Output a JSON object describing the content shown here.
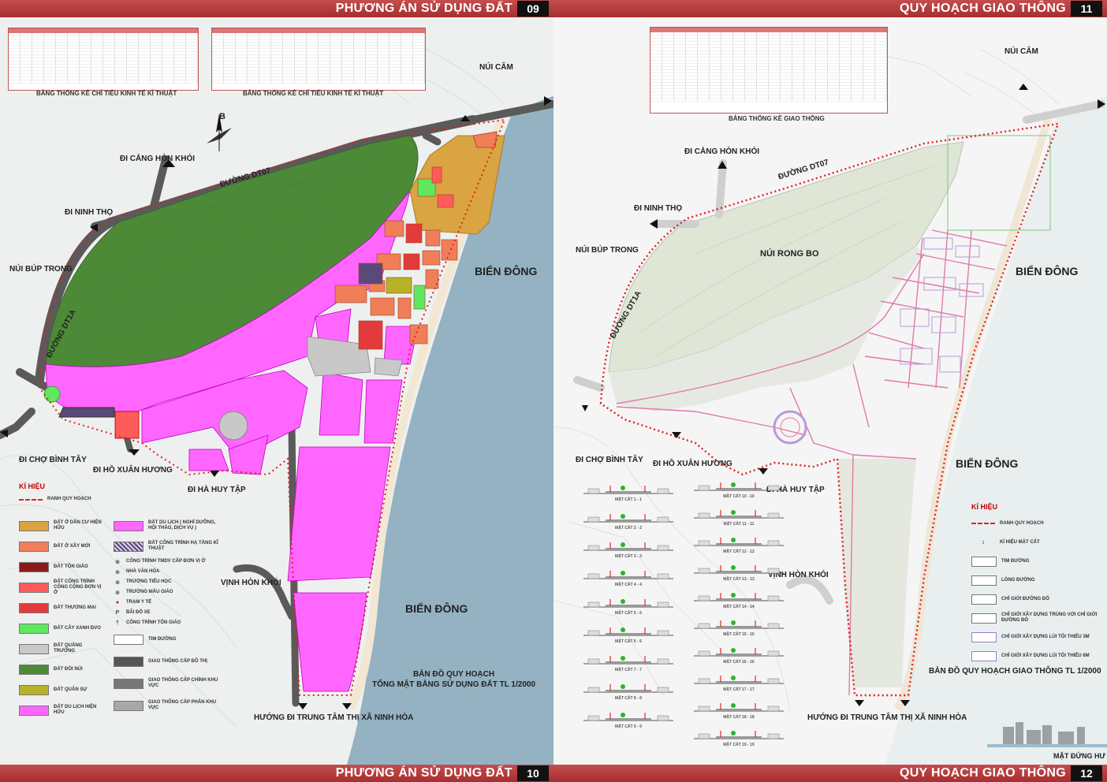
{
  "colors": {
    "orange_existing": "#d9a441",
    "orange_new": "#f07e58",
    "religion": "#8b1a1a",
    "public": "#ff5b5b",
    "commerce": "#e33b3b",
    "green": "#5fe85f",
    "square": "#c8c8c8",
    "mountain": "#4c8a38",
    "military": "#b6b329",
    "tourism": "#ff66ff",
    "infrastructure": "#5a4a7a",
    "sea": "#94b2c2",
    "road": "#5a5a5a",
    "boundary": "#e02020"
  },
  "left_page": {
    "top_bar": {
      "title": "PHƯƠNG ÁN SỬ DỤNG ĐẤT",
      "number": "09"
    },
    "bottom_bar": {
      "title": "PHƯƠNG ÁN SỬ DỤNG ĐẤT",
      "number": "10"
    },
    "table_caption_1": "BẢNG THỐNG KÊ CHỈ TIÊU KINH TẾ KĨ THUẬT",
    "table_caption_2": "BẢNG THỐNG KÊ CHỈ TIÊU KINH TẾ KĨ THUẬT",
    "labels": {
      "nui_cam": "NÚI CÂM",
      "di_cang": "ĐI CẢNG HÒN KHÓI",
      "duong_dt07": "ĐƯỜNG DT07",
      "di_ninh_tho": "ĐI NINH THỌ",
      "nui_bup_trong": "NÚI BÚP TRONG",
      "duong_dt1a": "ĐƯỜNG DT1A",
      "bien_dong_1": "BIỂN ĐÔNG",
      "bien_dong_2": "BIỂN ĐÔNG",
      "di_cho": "ĐI CHỢ BÌNH TÂY",
      "di_ho": "ĐI HỒ XUÂN HƯƠNG",
      "di_ha": "ĐI HÀ HUY TẬP",
      "vinh": "VỊNH HÒN KHÓI",
      "huong": "HƯỚNG ĐI TRUNG TÂM THỊ XÃ NINH HÒA",
      "map_title_1": "BẢN ĐỒ QUY HOẠCH",
      "map_title_2": "TỔNG MẶT BẰNG SỬ DỤNG ĐẤT TL 1/2000",
      "compass": "B"
    },
    "legend": {
      "title": "KÍ HIỆU",
      "boundary": "RANH QUY HOẠCH",
      "left": [
        {
          "label": "ĐẤT Ở DÂN CƯ HIỆN HỮU",
          "color": "#d9a441"
        },
        {
          "label": "ĐẤT Ở XÂY MỚI",
          "color": "#f07e58"
        },
        {
          "label": "ĐẤT TÔN GIÁO",
          "color": "#8b1a1a"
        },
        {
          "label": "ĐẤT CÔNG TRÌNH CÔNG CỘNG ĐƠN VỊ Ở",
          "color": "#ff5b5b"
        },
        {
          "label": "ĐẤT THƯƠNG MẠI",
          "color": "#e33b3b"
        },
        {
          "label": "ĐẤT CÂY XANH ĐVO",
          "color": "#5fe85f"
        },
        {
          "label": "ĐẤT QUẢNG TRƯỜNG",
          "color": "#c8c8c8"
        },
        {
          "label": "ĐẤT ĐỒI NÚI",
          "color": "#4c8a38"
        },
        {
          "label": "ĐẤT QUÂN SỰ",
          "color": "#b6b329"
        },
        {
          "label": "ĐẤT DU LỊCH HIỆN HỮU",
          "color": "#ff66ff"
        }
      ],
      "right_blocks": [
        {
          "label": "ĐẤT DU LỊCH ( NGHỈ DƯỠNG, HỘI THẢO, DỊCH VỤ )",
          "color": "#ff66ff"
        },
        {
          "label": "ĐẤT CÔNG TRÌNH HẠ TẦNG KĨ THUẬT",
          "color": "#5a4a7a"
        }
      ],
      "symbols": [
        {
          "label": "CÔNG TRÌNH TMDV CẤP ĐƠN VỊ Ở",
          "icon": "⊚"
        },
        {
          "label": "NHÀ VĂN HÓA",
          "icon": "⊚"
        },
        {
          "label": "TRƯỜNG TIỂU HỌC",
          "icon": "⊚"
        },
        {
          "label": "TRƯỜNG MẪU GIÁO",
          "icon": "⊚"
        },
        {
          "label": "TRẠM Y TẾ",
          "icon": "●"
        },
        {
          "label": "BÃI ĐỖ XE",
          "icon": "P"
        },
        {
          "label": "CÔNG TRÌNH TÔN GIÁO",
          "icon": "†"
        }
      ],
      "roads": [
        {
          "label": "TIM ĐƯỜNG",
          "color": "#ffffff"
        },
        {
          "label": "GIAO THÔNG CẤP ĐÔ THỊ",
          "color": "#555555"
        },
        {
          "label": "GIAO THÔNG CẤP CHÍNH KHU VỰC",
          "color": "#777777"
        },
        {
          "label": "GIAO THÔNG CẤP PHÂN KHU VỰC",
          "color": "#a8a8a8"
        }
      ]
    }
  },
  "right_page": {
    "top_bar": {
      "title": "QUY HOẠCH GIAO THÔNG",
      "number": "11"
    },
    "bottom_bar": {
      "title": "QUY HOẠCH GIAO THÔNG",
      "number": "12"
    },
    "table_caption": "BẢNG THỐNG KÊ GIAO THÔNG",
    "labels": {
      "nui_cam": "NÚI CÂM",
      "di_cang": "ĐI CẢNG HÒN KHÓI",
      "duong_dt07": "ĐƯỜNG DT07",
      "di_ninh_tho": "ĐI NINH THỌ",
      "nui_bup_trong": "NÚI BÚP TRONG",
      "nui_rong_bo": "NÚI RONG BO",
      "duong_dt1a": "ĐƯỜNG DT1A",
      "bien_dong_1": "BIỂN ĐÔNG",
      "bien_dong_2": "BIỂN ĐÔNG",
      "di_cho": "ĐI CHỢ BÌNH TÂY",
      "di_ho": "ĐI HỒ XUÂN HƯƠNG",
      "di_ha": "ĐI HÀ HUY TẬP",
      "vinh": "VỊNH HÒN KHÓI",
      "huong": "HƯỚNG ĐI TRUNG TÂM THỊ XÃ NINH HÒA",
      "map_title": "BẢN ĐỒ QUY HOẠCH GIAO THÔNG TL 1/2000",
      "mat_dung": "MẶT ĐỨNG HƯ"
    },
    "legend": {
      "title": "KÍ HIỆU",
      "items": [
        {
          "label": "RANH QUY HOẠCH",
          "kind": "boundary"
        },
        {
          "label": "KÍ HIỆU MẶT CẮT",
          "kind": "cut"
        },
        {
          "label": "TIM ĐƯỜNG",
          "kind": "box"
        },
        {
          "label": "LÒNG ĐƯỜNG",
          "kind": "box"
        },
        {
          "label": "CHỈ GIỚI ĐƯỜNG ĐỎ",
          "kind": "box"
        },
        {
          "label": "CHỈ GIỚI XÂY DỰNG TRÙNG VỚI CHỈ GIỚI ĐƯỜNG ĐỎ",
          "kind": "box"
        },
        {
          "label": "CHỈ GIỚI XÂY DỰNG LÙI TỐI THIỂU 3M",
          "kind": "box-purple"
        },
        {
          "label": "CHỈ GIỚI XÂY DỰNG LÙI TỐI THIỂU 6M",
          "kind": "box-purple"
        }
      ]
    },
    "sections_left": [
      "MẶT CẮT 1 - 1",
      "MẶT CẮT 2 - 2",
      "MẶT CẮT 3 - 3",
      "MẶT CẮT 4 - 4",
      "MẶT CẮT 5 - 5",
      "MẶT CẮT 6 - 6",
      "MẶT CẮT 7 - 7",
      "MẶT CẮT 8 - 8",
      "MẶT CẮT 9 - 9"
    ],
    "sections_right": [
      "MẶT CẮT 10 - 10",
      "MẶT CẮT 11 - 11",
      "MẶT CẮT 12 - 12",
      "MẶT CẮT 13 - 13",
      "MẶT CẮT 14 - 14",
      "MẶT CẮT 15 - 15",
      "MẶT CẮT 16 - 16",
      "MẶT CẮT 17 - 17",
      "MẶT CẮT 18 - 18",
      "MẶT CẮT 19 - 19"
    ]
  }
}
